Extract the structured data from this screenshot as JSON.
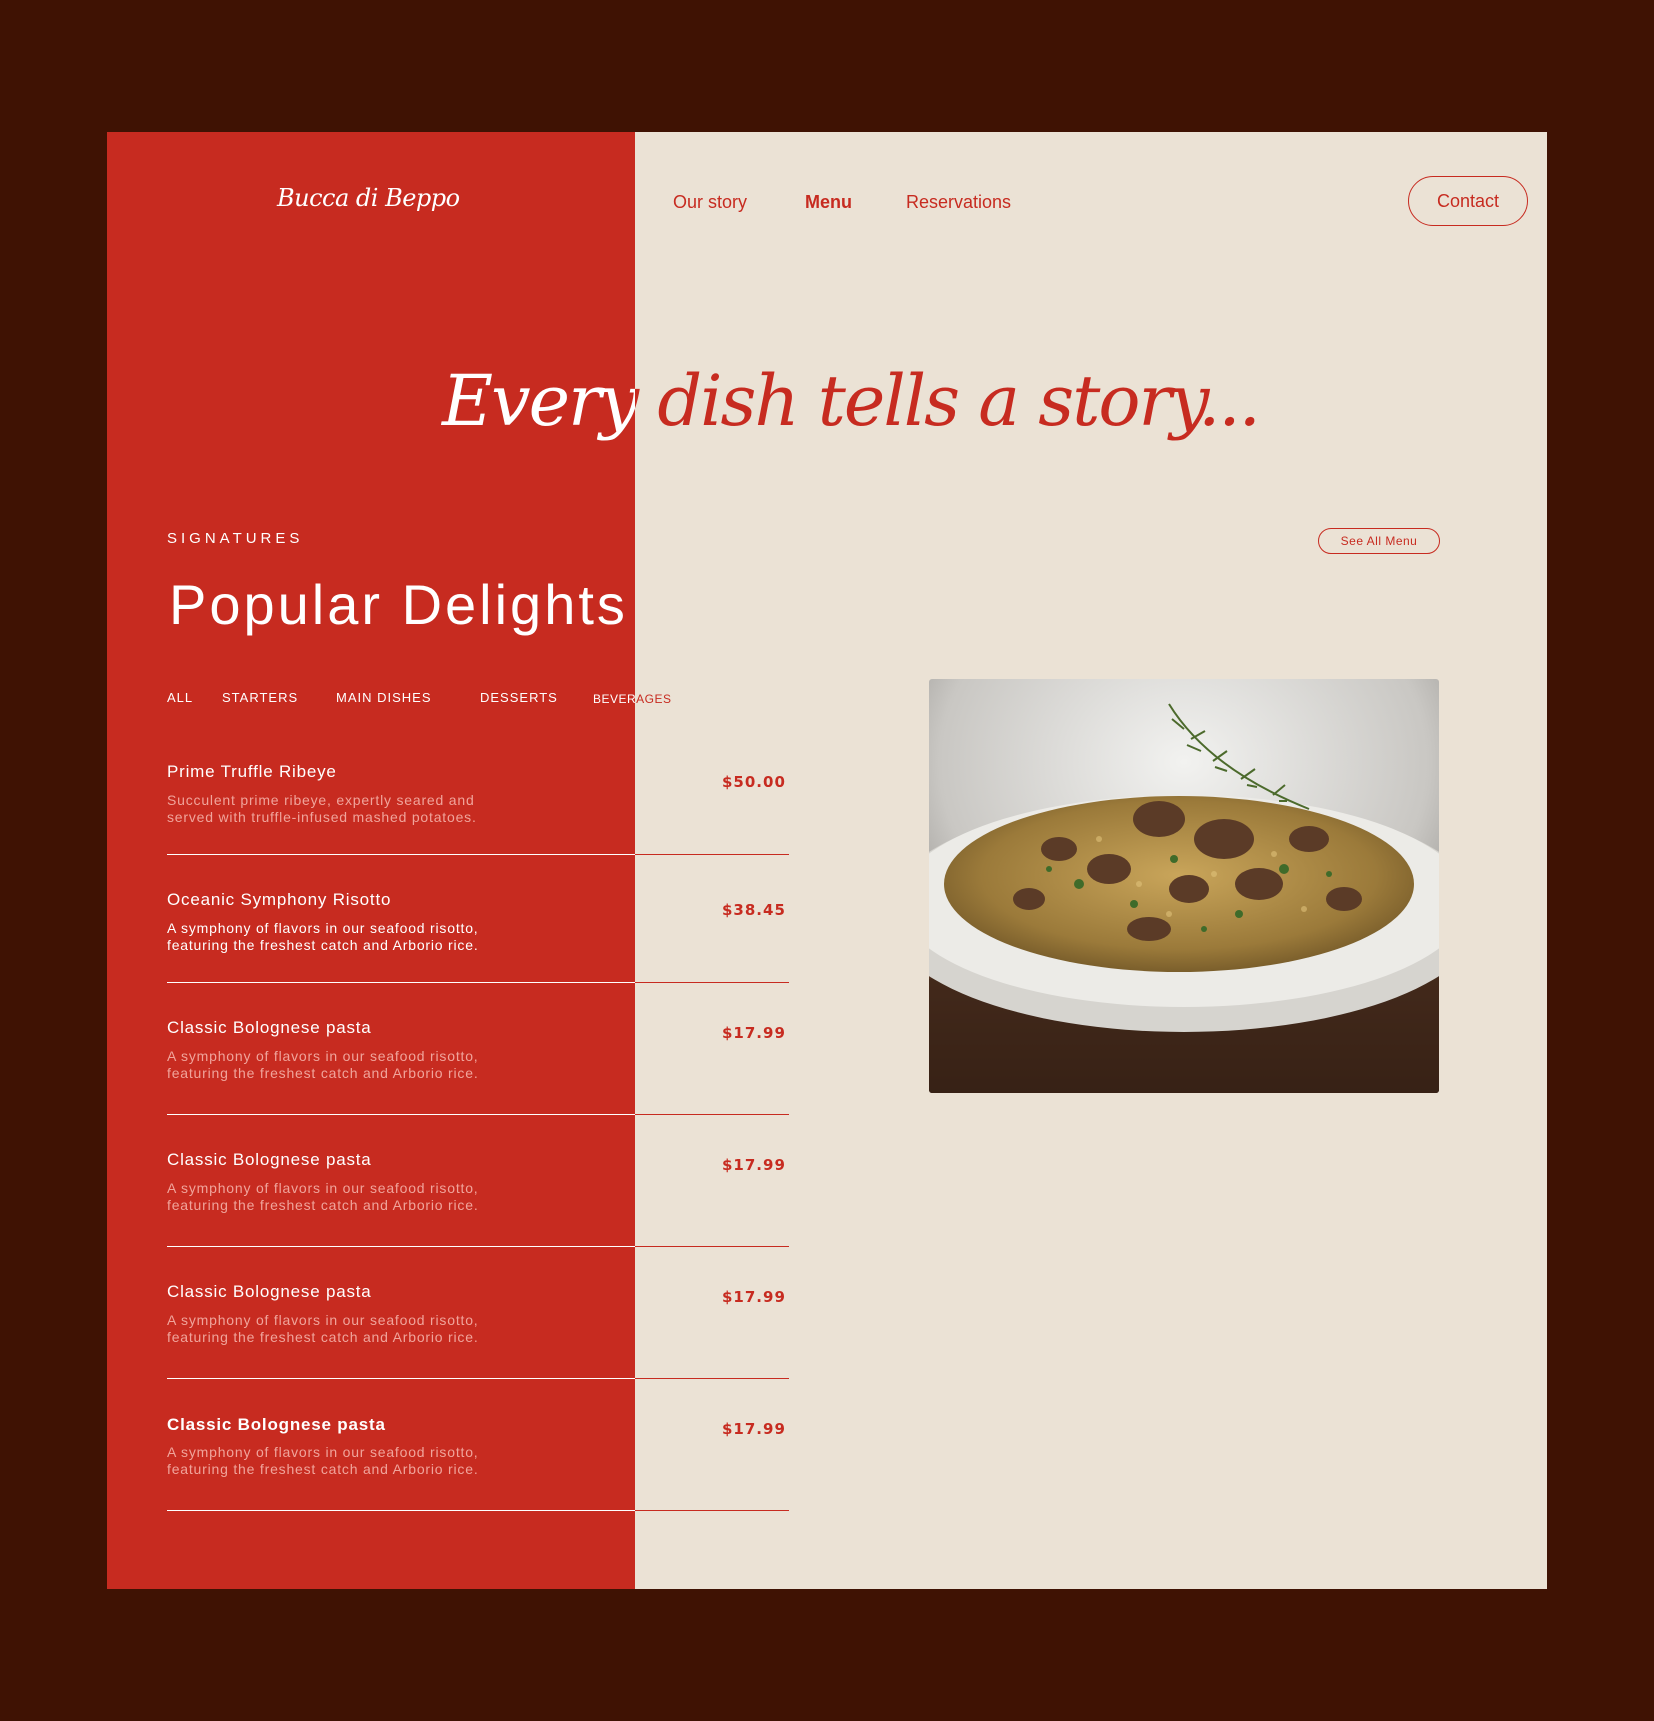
{
  "brand": {
    "logo": "Bucca di Beppo"
  },
  "nav": {
    "items": [
      "Our story",
      "Menu",
      "Reservations"
    ],
    "active": "Menu",
    "contact": "Contact"
  },
  "hero": {
    "headline": "Every dish tells a story..."
  },
  "section": {
    "eyebrow": "SIGNATURES",
    "title": "Popular Delights",
    "see_all": "See All Menu"
  },
  "tabs": [
    "ALL",
    "STARTERS",
    "MAIN DISHES",
    "DESSERTS",
    "BEVERAGES"
  ],
  "menu_items": [
    {
      "name": "Prime Truffle Ribeye",
      "desc_line1": "Succulent prime ribeye, expertly seared and",
      "desc_line2": "served with truffle-infused mashed potatoes.",
      "price": "$50.00"
    },
    {
      "name": "Oceanic Symphony Risotto",
      "desc_line1": "A symphony of flavors in our seafood risotto,",
      "desc_line2": "featuring the freshest catch and Arborio rice.",
      "price": "$38.45"
    },
    {
      "name": "Classic Bolognese pasta",
      "desc_line1": "A symphony of flavors in our seafood risotto,",
      "desc_line2": "featuring the freshest catch and Arborio rice.",
      "price": "$17.99"
    },
    {
      "name": "Classic Bolognese pasta",
      "desc_line1": "A symphony of flavors in our seafood risotto,",
      "desc_line2": "featuring the freshest catch and Arborio rice.",
      "price": "$17.99"
    },
    {
      "name": "Classic Bolognese pasta",
      "desc_line1": "A symphony of flavors in our seafood risotto,",
      "desc_line2": "featuring the freshest catch and Arborio rice.",
      "price": "$17.99"
    },
    {
      "name": "Classic Bolognese pasta",
      "desc_line1": "A symphony of flavors in our seafood risotto,",
      "desc_line2": "featuring the freshest catch and Arborio rice.",
      "price": "$17.99"
    }
  ],
  "colors": {
    "outer_bg": "#3f1203",
    "red": "#c72b20",
    "cream": "#ebe2d5"
  },
  "image": {
    "icon": "risotto-dish-photo"
  }
}
